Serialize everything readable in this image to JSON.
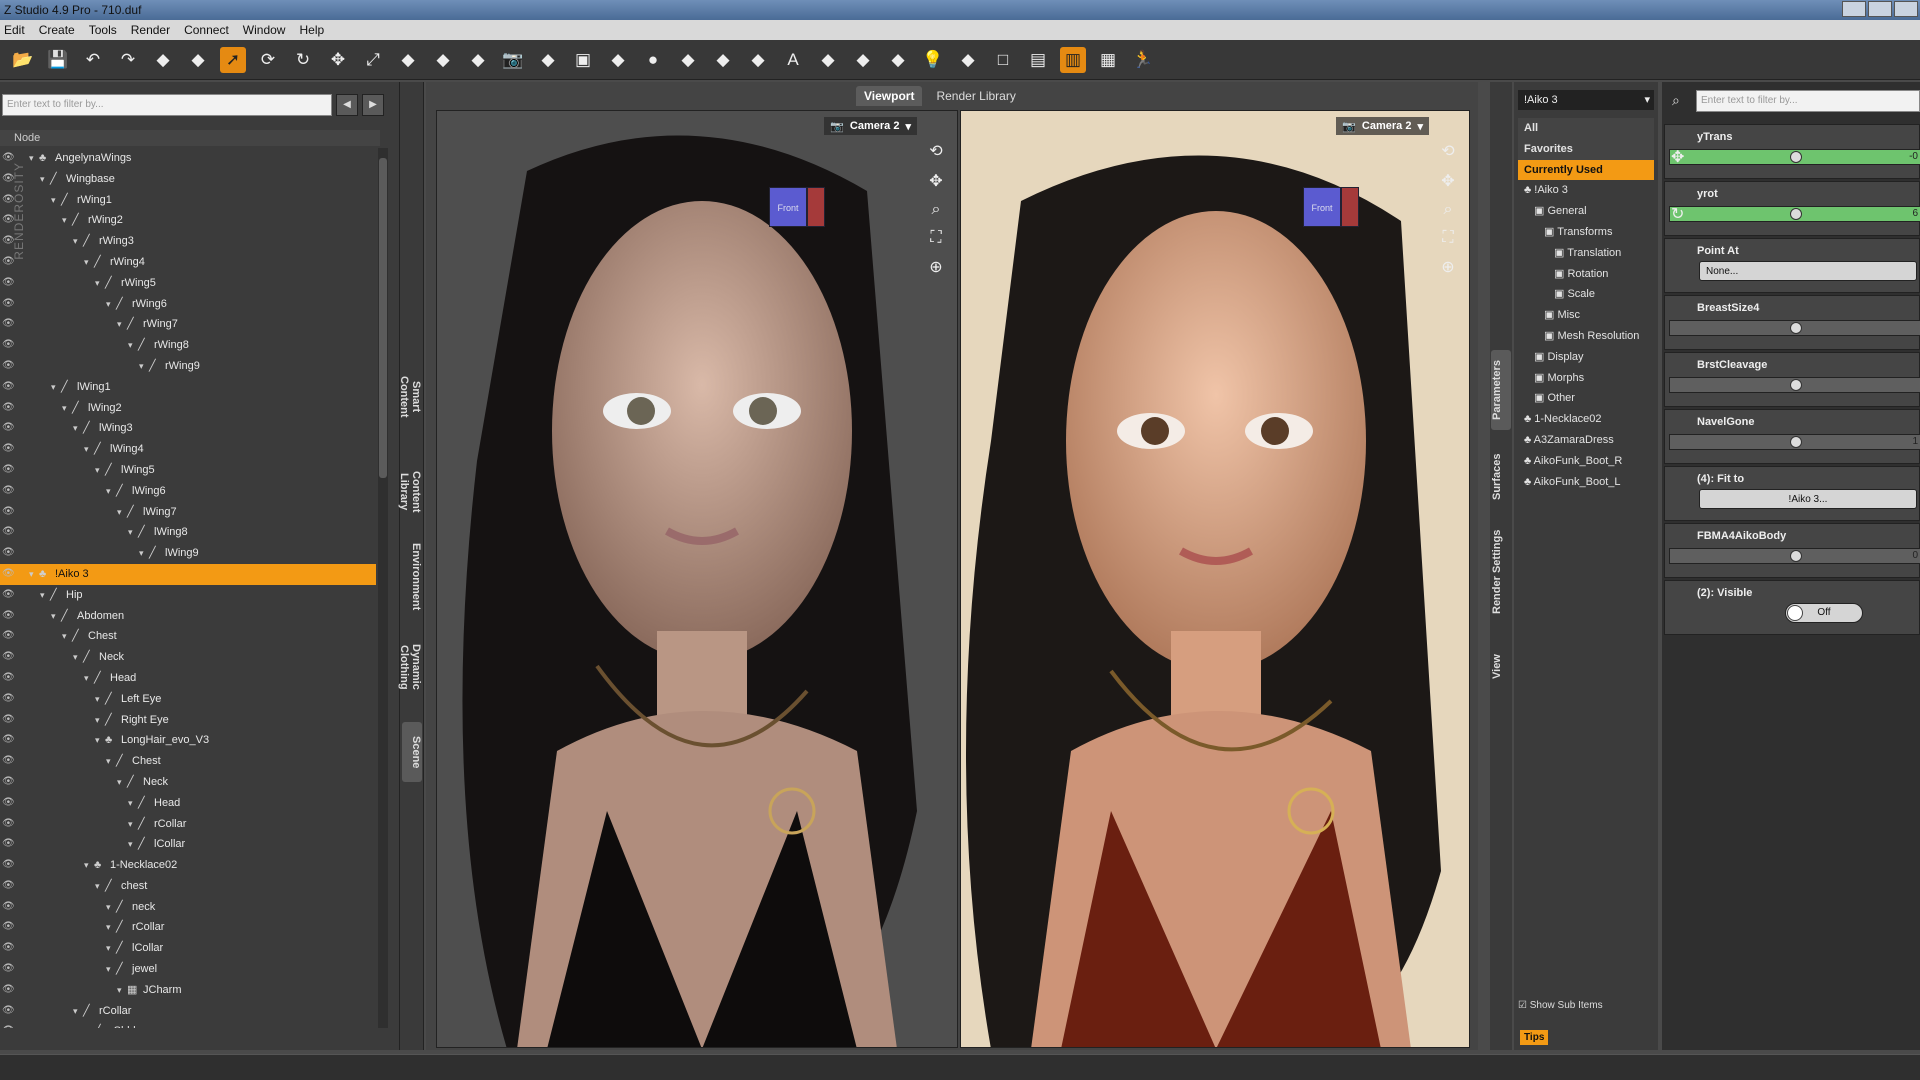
{
  "window": {
    "title": "Z Studio 4.9 Pro - 710.duf"
  },
  "menu": [
    "Edit",
    "Create",
    "Tools",
    "Render",
    "Connect",
    "Window",
    "Help"
  ],
  "toolbar": {
    "icons": [
      "open-icon",
      "save-icon",
      "undo-icon",
      "redo-icon",
      "group-icon",
      "paint-icon",
      "select-arrow-icon",
      "orbit-icon",
      "rotate-icon",
      "translate-icon",
      "scale-icon",
      "node-icon",
      "copy-icon",
      "paste-icon",
      "camera-icon",
      "camera-add-icon",
      "render-icon",
      "texture-icon",
      "sphere-icon",
      "pose-icon",
      "figure-icon",
      "joint-icon",
      "text-icon",
      "import-icon",
      "morph-icon",
      "rig-icon",
      "light-icon",
      "edit-icon",
      "layout-single-icon",
      "layout-split-icon",
      "layout-double-icon",
      "layout-quad-icon",
      "run-icon"
    ]
  },
  "scene_panel": {
    "filter_placeholder": "Enter text to filter by...",
    "header": "Node",
    "watermark": "RENDEROSITY",
    "nodes": [
      {
        "label": "AngelynaWings",
        "depth": 1,
        "type": "figure"
      },
      {
        "label": "Wingbase",
        "depth": 2,
        "type": "bone"
      },
      {
        "label": "rWing1",
        "depth": 3,
        "type": "bone"
      },
      {
        "label": "rWing2",
        "depth": 4,
        "type": "bone"
      },
      {
        "label": "rWing3",
        "depth": 5,
        "type": "bone"
      },
      {
        "label": "rWing4",
        "depth": 6,
        "type": "bone"
      },
      {
        "label": "rWing5",
        "depth": 7,
        "type": "bone"
      },
      {
        "label": "rWing6",
        "depth": 8,
        "type": "bone"
      },
      {
        "label": "rWing7",
        "depth": 9,
        "type": "bone"
      },
      {
        "label": "rWing8",
        "depth": 10,
        "type": "bone"
      },
      {
        "label": "rWing9",
        "depth": 11,
        "type": "bone"
      },
      {
        "label": "lWing1",
        "depth": 3,
        "type": "bone"
      },
      {
        "label": "lWing2",
        "depth": 4,
        "type": "bone"
      },
      {
        "label": "lWing3",
        "depth": 5,
        "type": "bone"
      },
      {
        "label": "lWing4",
        "depth": 6,
        "type": "bone"
      },
      {
        "label": "lWing5",
        "depth": 7,
        "type": "bone"
      },
      {
        "label": "lWing6",
        "depth": 8,
        "type": "bone"
      },
      {
        "label": "lWing7",
        "depth": 9,
        "type": "bone"
      },
      {
        "label": "lWing8",
        "depth": 10,
        "type": "bone"
      },
      {
        "label": "lWing9",
        "depth": 11,
        "type": "bone"
      },
      {
        "label": "!Aiko 3",
        "depth": 1,
        "type": "figure",
        "selected": true
      },
      {
        "label": "Hip",
        "depth": 2,
        "type": "bone"
      },
      {
        "label": "Abdomen",
        "depth": 3,
        "type": "bone"
      },
      {
        "label": "Chest",
        "depth": 4,
        "type": "bone"
      },
      {
        "label": "Neck",
        "depth": 5,
        "type": "bone"
      },
      {
        "label": "Head",
        "depth": 6,
        "type": "bone"
      },
      {
        "label": "Left Eye",
        "depth": 7,
        "type": "bone"
      },
      {
        "label": "Right Eye",
        "depth": 7,
        "type": "bone"
      },
      {
        "label": "LongHair_evo_V3",
        "depth": 7,
        "type": "figure"
      },
      {
        "label": "Chest",
        "depth": 8,
        "type": "bone"
      },
      {
        "label": "Neck",
        "depth": 9,
        "type": "bone"
      },
      {
        "label": "Head",
        "depth": 10,
        "type": "bone"
      },
      {
        "label": "rCollar",
        "depth": 10,
        "type": "bone"
      },
      {
        "label": "lCollar",
        "depth": 10,
        "type": "bone"
      },
      {
        "label": "1-Necklace02",
        "depth": 6,
        "type": "figure"
      },
      {
        "label": "chest",
        "depth": 7,
        "type": "bone"
      },
      {
        "label": "neck",
        "depth": 8,
        "type": "bone"
      },
      {
        "label": "rCollar",
        "depth": 8,
        "type": "bone"
      },
      {
        "label": "lCollar",
        "depth": 8,
        "type": "bone"
      },
      {
        "label": "jewel",
        "depth": 8,
        "type": "bone"
      },
      {
        "label": "JCharm",
        "depth": 9,
        "type": "prop"
      },
      {
        "label": "rCollar",
        "depth": 5,
        "type": "bone"
      },
      {
        "label": "rShldr",
        "depth": 6,
        "type": "bone"
      }
    ]
  },
  "left_vtabs": [
    "Smart Content",
    "Content Library",
    "Environment",
    "Dynamic Clothing",
    "Scene"
  ],
  "center": {
    "tabs": [
      "Viewport",
      "Render Library"
    ],
    "viewports": [
      {
        "camera": "Camera 2",
        "cube_label": "Front"
      },
      {
        "camera": "Camera 2",
        "cube_label": "Front"
      }
    ]
  },
  "right_vtabs": [
    "Parameters",
    "Surfaces",
    "Render Settings",
    "View"
  ],
  "node_panel": {
    "selected_node": "!Aiko 3",
    "items": [
      {
        "label": "All",
        "kind": "hd"
      },
      {
        "label": "Favorites",
        "kind": "hd"
      },
      {
        "label": "Currently Used",
        "kind": "cur"
      },
      {
        "label": "!Aiko 3",
        "depth": 0
      },
      {
        "label": "General",
        "depth": 1
      },
      {
        "label": "Transforms",
        "depth": 2
      },
      {
        "label": "Translation",
        "depth": 3
      },
      {
        "label": "Rotation",
        "depth": 3
      },
      {
        "label": "Scale",
        "depth": 3
      },
      {
        "label": "Misc",
        "depth": 2
      },
      {
        "label": "Mesh Resolution",
        "depth": 2
      },
      {
        "label": "Display",
        "depth": 1
      },
      {
        "label": "Morphs",
        "depth": 1
      },
      {
        "label": "Other",
        "depth": 1
      },
      {
        "label": "1-Necklace02",
        "depth": 0
      },
      {
        "label": "A3ZamaraDress",
        "depth": 0
      },
      {
        "label": "AikoFunk_Boot_R",
        "depth": 0
      },
      {
        "label": "AikoFunk_Boot_L",
        "depth": 0
      }
    ],
    "show_sub_items": "Show Sub Items",
    "tips": "Tips"
  },
  "params": {
    "filter_placeholder": "Enter text to filter by...",
    "cards": [
      {
        "label": "yTrans",
        "kind": "slider",
        "green": true,
        "value_text": "-0"
      },
      {
        "label": "yrot",
        "kind": "slider",
        "green": true,
        "value_text": "6"
      },
      {
        "label": "Point At",
        "kind": "button",
        "button": "None..."
      },
      {
        "label": "BreastSize4",
        "kind": "slider",
        "value_text": ""
      },
      {
        "label": "BrstCleavage",
        "kind": "slider",
        "value_text": ""
      },
      {
        "label": "NavelGone",
        "kind": "slider",
        "value_text": "1"
      },
      {
        "label": "(4): Fit to",
        "kind": "button",
        "button": "!Aiko 3..."
      },
      {
        "label": "FBMA4AikoBody",
        "kind": "slider",
        "value_text": "0"
      },
      {
        "label": "(2): Visible",
        "kind": "toggle",
        "button": "Off"
      }
    ]
  }
}
